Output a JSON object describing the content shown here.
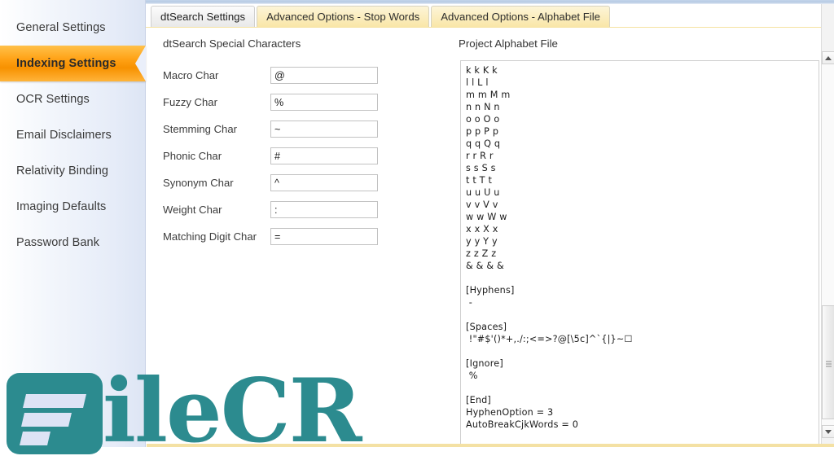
{
  "window": {
    "title": "dtSearch Settings"
  },
  "sidebar": {
    "items": [
      {
        "label": "General Settings",
        "active": false
      },
      {
        "label": "Indexing Settings",
        "active": true
      },
      {
        "label": "OCR Settings",
        "active": false
      },
      {
        "label": "Email Disclaimers",
        "active": false
      },
      {
        "label": "Relativity Binding",
        "active": false
      },
      {
        "label": "Imaging Defaults",
        "active": false
      },
      {
        "label": "Password Bank",
        "active": false
      }
    ]
  },
  "tabs": [
    {
      "label": "dtSearch Settings",
      "active": true
    },
    {
      "label": "Advanced Options - Stop Words",
      "active": false
    },
    {
      "label": "Advanced Options - Alphabet File",
      "active": false
    }
  ],
  "main": {
    "specials_title": "dtSearch Special Characters",
    "alphabet_title": "Project Alphabet File",
    "fields": [
      {
        "label": "Macro Char",
        "value": "@"
      },
      {
        "label": "Fuzzy Char",
        "value": "%"
      },
      {
        "label": "Stemming Char",
        "value": "~"
      },
      {
        "label": "Phonic Char",
        "value": "#"
      },
      {
        "label": "Synonym Char",
        "value": "^"
      },
      {
        "label": "Weight Char",
        "value": ":"
      },
      {
        "label": "Matching Digit Char",
        "value": "="
      }
    ],
    "alphabet_file": "k k K k\nl l L l\nm m M m\nn n N n\no o O o\np p P p\nq q Q q\nr r R r\ns s S s\nt t T t\nu u U u\nv v V v\nw w W w\nx x X x\ny y Y y\nz z Z z\n& & & &\n\n[Hyphens]\n -\n\n[Spaces]\n !\"#$'()*+,./:;<=>?@[\\5c]^`{|}~☐\n\n[Ignore]\n %\n\n[End]\nHyphenOption = 3\nAutoBreakCjkWords = 0"
  },
  "scrollbar": {
    "up_arrow": "scroll-up",
    "down_arrow": "scroll-down"
  },
  "watermark": {
    "text": "ileCR",
    "color": "#2c8b8f"
  },
  "colors": {
    "accent_orange": "#f79100",
    "tab_yellow": "#f9e6a8",
    "gold_rule": "#f4e1a4",
    "sidebar_blue": "#e6ecf8",
    "watermark_teal": "#2c8b8f"
  }
}
